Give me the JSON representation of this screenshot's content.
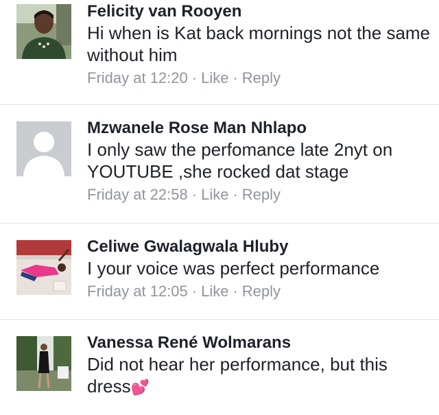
{
  "comments": [
    {
      "name": "Felicity van Rooyen",
      "text": "Hi when is Kat back mornings not the same without him",
      "time": "Friday at 12:20",
      "like": "Like",
      "reply": "Reply"
    },
    {
      "name": "Mzwanele Rose Man Nhlapo",
      "text": "I only saw the perfomance late 2nyt on YOUTUBE ,she rocked dat stage",
      "time": "Friday at 22:58",
      "like": "Like",
      "reply": "Reply"
    },
    {
      "name": "Celiwe Gwalagwala Hluby",
      "text": "I your voice was perfect performance",
      "time": "Friday at 12:05",
      "like": "Like",
      "reply": "Reply"
    },
    {
      "name": "Vanessa René Wolmarans",
      "text": "Did not hear her performance, but this dress",
      "emoji": "💕",
      "emoji_name": "two-hearts-icon"
    }
  ],
  "meta_separator": "·",
  "colors": {
    "name_text": "#1d2129",
    "meta_text": "#90949c",
    "divider": "#e2e3e6",
    "placeholder_avatar_bg": "#c9ccd1"
  }
}
